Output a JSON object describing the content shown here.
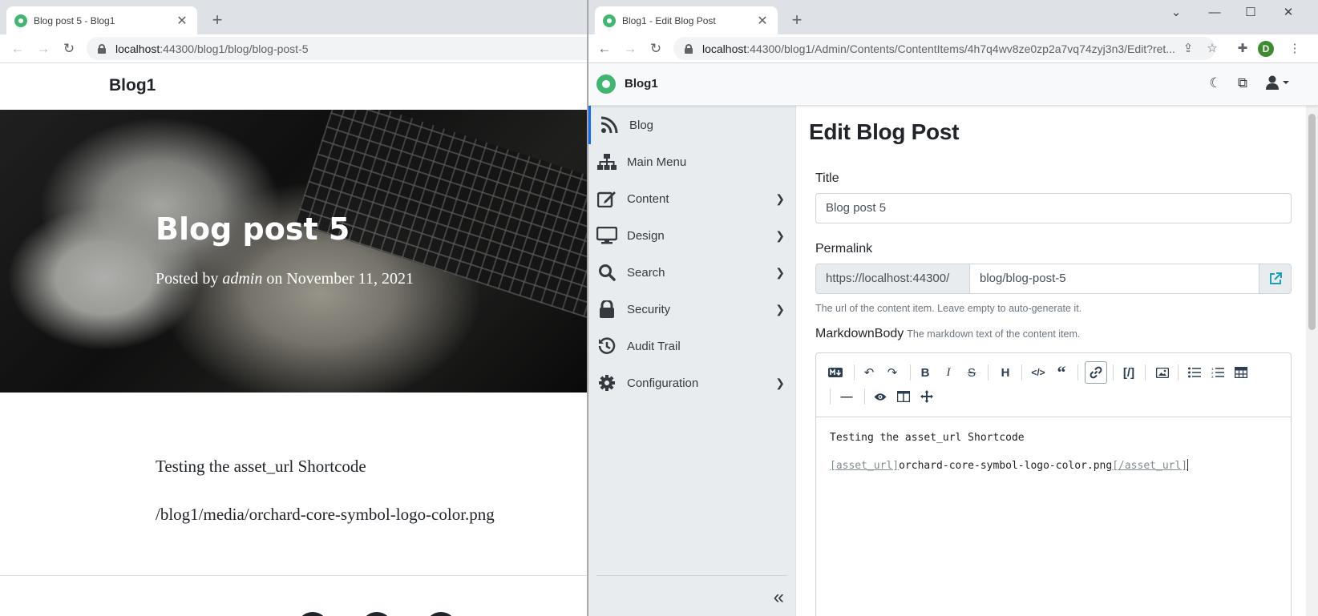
{
  "left_window": {
    "tab_title": "Blog post 5 - Blog1",
    "url_host": "localhost",
    "url_path": ":44300/blog1/blog/blog-post-5",
    "brand": "Blog1",
    "post_title": "Blog post 5",
    "meta_prefix": "Posted by ",
    "meta_author": "admin",
    "meta_mid": " on ",
    "meta_date": "November 11, 2021",
    "paragraphs": [
      "Testing the asset_url Shortcode",
      "/blog1/media/orchard-core-symbol-logo-color.png"
    ]
  },
  "right_window": {
    "tab_title": "Blog1 - Edit Blog Post",
    "url_host": "localhost",
    "url_path": ":44300/blog1/Admin/Contents/ContentItems/4h7q4wv8ze0zp2a7vq74zyj3n3/Edit?ret...",
    "profile_initial": "D",
    "brand": "Blog1",
    "sidebar": [
      {
        "label": "Blog",
        "icon": "rss-icon",
        "has_chevron": false,
        "active": true
      },
      {
        "label": "Main Menu",
        "icon": "sitemap-icon",
        "has_chevron": false,
        "active": false
      },
      {
        "label": "Content",
        "icon": "edit-icon",
        "has_chevron": true,
        "active": false
      },
      {
        "label": "Design",
        "icon": "desktop-icon",
        "has_chevron": true,
        "active": false
      },
      {
        "label": "Search",
        "icon": "search-icon",
        "has_chevron": true,
        "active": false
      },
      {
        "label": "Security",
        "icon": "lock-icon",
        "has_chevron": true,
        "active": false
      },
      {
        "label": "Audit Trail",
        "icon": "history-icon",
        "has_chevron": false,
        "active": false
      },
      {
        "label": "Configuration",
        "icon": "cog-icon",
        "has_chevron": true,
        "active": false
      }
    ],
    "page_title": "Edit Blog Post",
    "title_label": "Title",
    "title_value": "Blog post 5",
    "permalink_label": "Permalink",
    "permalink_prefix": "https://localhost:44300/",
    "permalink_value": "blog/blog-post-5",
    "permalink_hint": "The url of the content item. Leave empty to auto-generate it.",
    "markdown_label": "MarkdownBody",
    "markdown_hint": "The markdown text of the content item.",
    "editor_line1": "Testing the asset_url Shortcode",
    "editor_line2_open": "[asset_url]",
    "editor_line2_value": "orchard-core-symbol-logo-color.png",
    "editor_line2_close": "[/asset_url]",
    "toolbar_buttons": [
      "markdown-icon",
      "undo-icon",
      "redo-icon",
      "bold-icon",
      "italic-icon",
      "strikethrough-icon",
      "heading-icon",
      "code-icon",
      "quote-icon",
      "link-icon",
      "shortcode-icon",
      "image-icon",
      "unordered-list-icon",
      "ordered-list-icon",
      "table-icon",
      "horizontal-rule-icon",
      "preview-icon",
      "side-by-side-icon",
      "fullscreen-icon"
    ]
  },
  "colors": {
    "accent": "#0d6efd",
    "orchard_green": "#41b670",
    "sidebar_bg": "#e9ecef"
  }
}
